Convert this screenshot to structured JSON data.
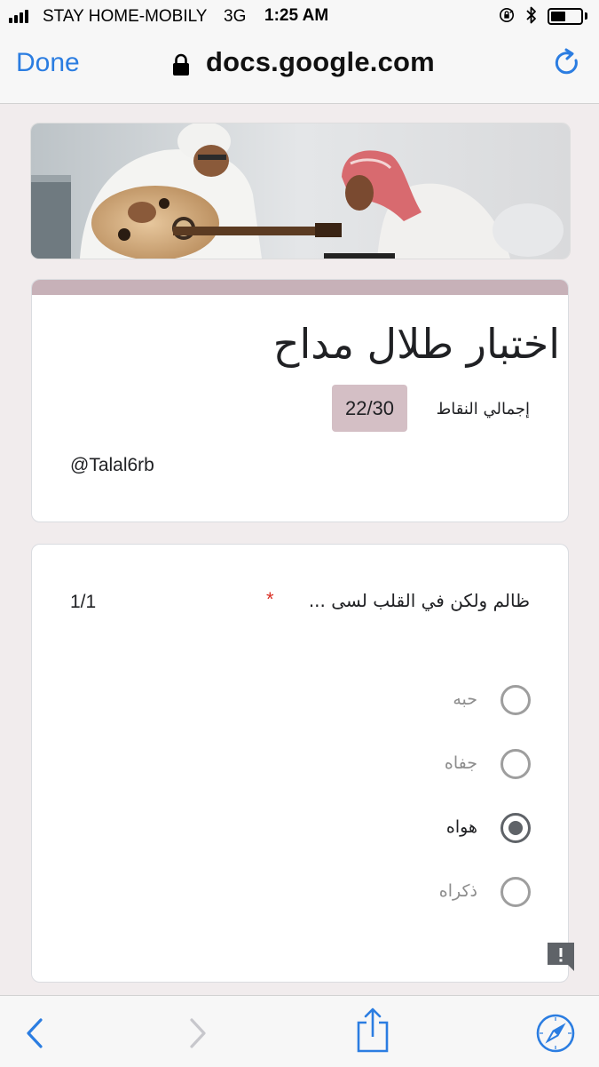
{
  "status_bar": {
    "carrier": "STAY HOME-MOBILY",
    "network": "3G",
    "time": "1:25 AM",
    "battery_level": 0.5
  },
  "browser": {
    "done_label": "Done",
    "url": "docs.google.com"
  },
  "form": {
    "title": "اختبار طلال مداح",
    "points_label": "إجمالي النقاط",
    "score": "22/30",
    "description": "@Talal6rb",
    "accent_color": "#c7b1b8"
  },
  "question": {
    "text": "ظالم ولكن في القلب لسى ...",
    "required_mark": "*",
    "points": "1/1",
    "options": [
      {
        "label": "حبه",
        "selected": false
      },
      {
        "label": "جفاه",
        "selected": false
      },
      {
        "label": "هواه",
        "selected": true
      },
      {
        "label": "ذكراه",
        "selected": false
      }
    ]
  },
  "icons": {
    "back": "chevron-left-icon",
    "forward": "chevron-right-icon",
    "share": "share-icon",
    "safari": "compass-icon",
    "reload": "reload-icon",
    "lock": "lock-icon",
    "feedback": "report-issue-icon"
  },
  "colors": {
    "link_blue": "#2b7de1",
    "required_red": "#d93025"
  }
}
